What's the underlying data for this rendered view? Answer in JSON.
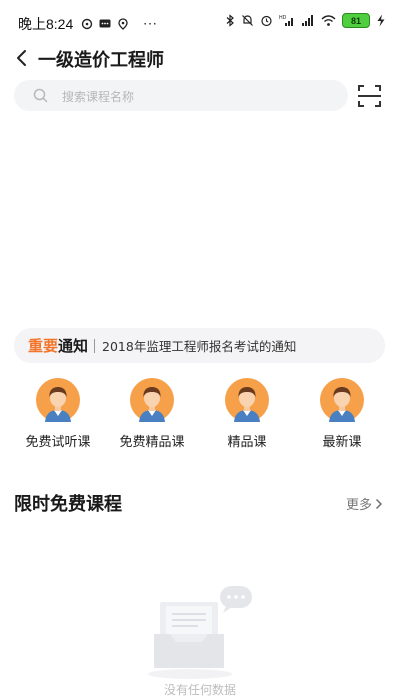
{
  "status_bar": {
    "time": "晚上8:24",
    "battery": "81"
  },
  "nav": {
    "title": "一级造价工程师"
  },
  "search": {
    "placeholder": "搜索课程名称"
  },
  "notice": {
    "tag_part1": "重要",
    "tag_part2": "通知",
    "text": "2018年监理工程师报名考试的通知"
  },
  "categories": [
    {
      "label": "免费试听课"
    },
    {
      "label": "免费精品课"
    },
    {
      "label": "精品课"
    },
    {
      "label": "最新课"
    }
  ],
  "section": {
    "title": "限时免费课程",
    "more": "更多"
  },
  "empty": {
    "text": "没有任何数据"
  },
  "colors": {
    "accent": "#f2752a",
    "avatar_bg": "#f7a04a"
  }
}
